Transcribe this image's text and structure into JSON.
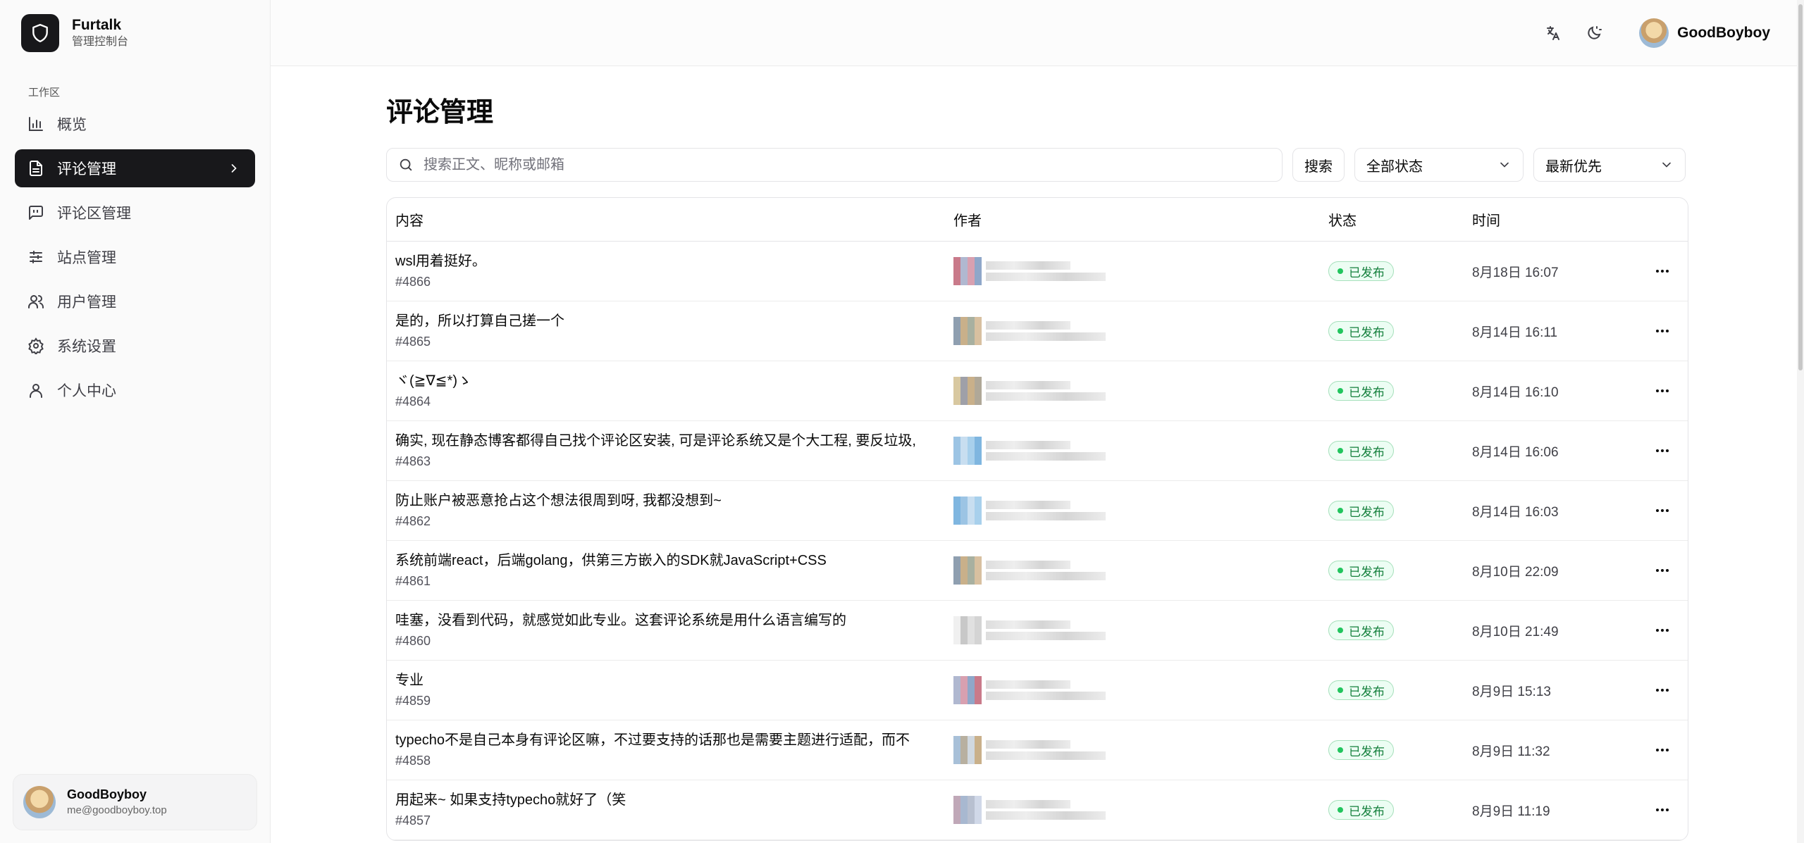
{
  "brand": {
    "name": "Furtalk",
    "subtitle": "管理控制台"
  },
  "sidebar": {
    "group_label": "工作区",
    "items": [
      {
        "label": "概览",
        "icon": "bar-chart-icon"
      },
      {
        "label": "评论管理",
        "icon": "document-icon",
        "active": true
      },
      {
        "label": "评论区管理",
        "icon": "message-square-icon"
      },
      {
        "label": "站点管理",
        "icon": "sliders-icon"
      },
      {
        "label": "用户管理",
        "icon": "users-icon"
      },
      {
        "label": "系统设置",
        "icon": "gear-icon"
      },
      {
        "label": "个人中心",
        "icon": "user-icon"
      }
    ],
    "user": {
      "name": "GoodBoyboy",
      "email": "me@goodboyboy.top"
    }
  },
  "topbar": {
    "user_name": "GoodBoyboy",
    "icons": [
      "translate-icon",
      "theme-toggle-icon"
    ]
  },
  "page": {
    "title": "评论管理"
  },
  "toolbar": {
    "search_placeholder": "搜索正文、昵称或邮箱",
    "search_button": "搜索",
    "status_filter": "全部状态",
    "sort": "最新优先"
  },
  "table": {
    "headers": {
      "content": "内容",
      "author": "作者",
      "status": "状态",
      "time": "时间"
    },
    "rows": [
      {
        "text": "wsl用着挺好。",
        "id": "#4866",
        "status": "已发布",
        "time": "8月18日 16:07"
      },
      {
        "text": "是的，所以打算自己搓一个",
        "id": "#4865",
        "status": "已发布",
        "time": "8月14日 16:11"
      },
      {
        "text": "ヾ(≧∇≦*)ゝ",
        "id": "#4864",
        "status": "已发布",
        "time": "8月14日 16:10"
      },
      {
        "text": "确实, 现在静态博客都得自己找个评论区安装, 可是评论系统又是个大工程, 要反垃圾,",
        "id": "#4863",
        "status": "已发布",
        "time": "8月14日 16:06"
      },
      {
        "text": "防止账户被恶意抢占这个想法很周到呀, 我都没想到~",
        "id": "#4862",
        "status": "已发布",
        "time": "8月14日 16:03"
      },
      {
        "text": "系统前端react，后端golang，供第三方嵌入的SDK就JavaScript+CSS",
        "id": "#4861",
        "status": "已发布",
        "time": "8月10日 22:09"
      },
      {
        "text": "哇塞，没看到代码，就感觉如此专业。这套评论系统是用什么语言编写的",
        "id": "#4860",
        "status": "已发布",
        "time": "8月10日 21:49"
      },
      {
        "text": "专业",
        "id": "#4859",
        "status": "已发布",
        "time": "8月9日 15:13"
      },
      {
        "text": "typecho不是自己本身有评论区嘛，不过要支持的话那也是需要主题进行适配，而不",
        "id": "#4858",
        "status": "已发布",
        "time": "8月9日 11:32"
      },
      {
        "text": "用起来~ 如果支持typecho就好了（笑",
        "id": "#4857",
        "status": "已发布",
        "time": "8月9日 11:19"
      }
    ]
  },
  "colors": {
    "accent": "#18181b",
    "status_published": "#15803d",
    "status_dot": "#22c55e"
  }
}
